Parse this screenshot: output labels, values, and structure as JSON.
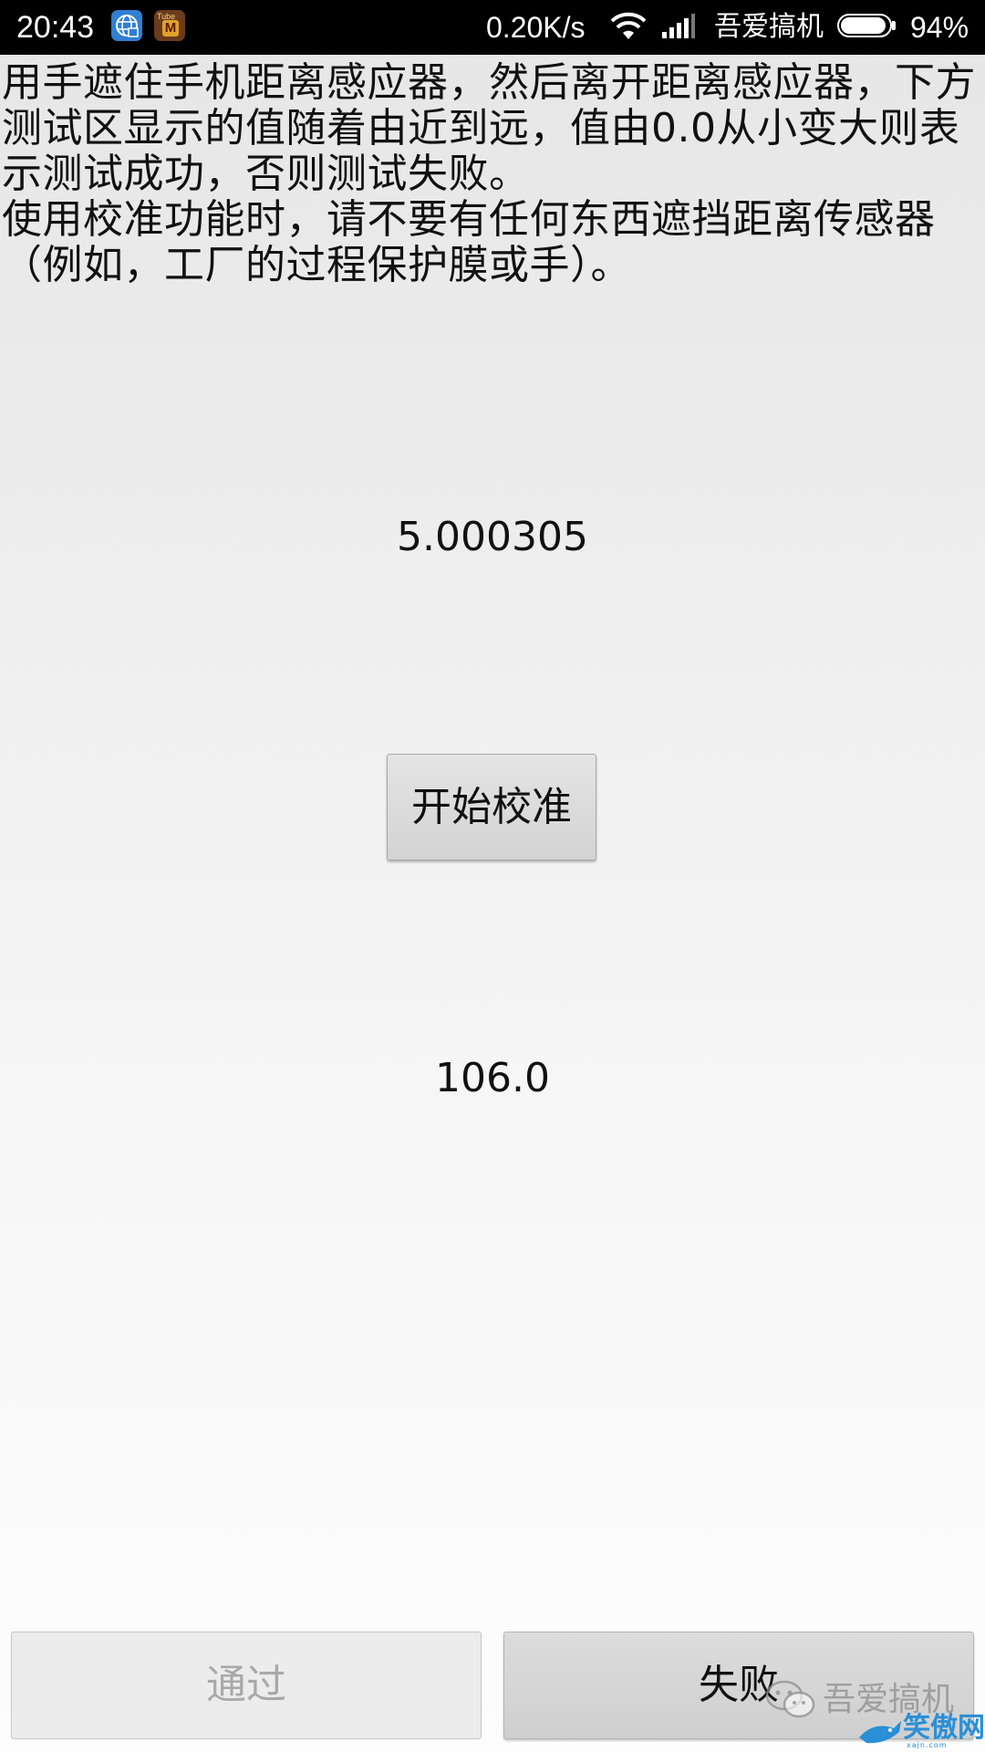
{
  "status_bar": {
    "time": "20:43",
    "network_speed": "0.20K/s",
    "carrier": "吾爱搞机",
    "battery_percent": "94%",
    "battery_level": 0.94,
    "app_icons": [
      "browser-globe-icon",
      "game-app-icon"
    ],
    "game_icon_text": "Tube",
    "game_icon_letter": "M"
  },
  "instructions": {
    "paragraph_1": "用手遮住手机距离感应器，然后离开距离感应器，下方测试区显示的值随着由近到远，值由0.0从小变大则表示测试成功，否则测试失败。",
    "paragraph_2": "使用校准功能时，请不要有任何东西遮挡距离传感器（例如，工厂的过程保护膜或手）。"
  },
  "readings": {
    "value_1": "5.000305",
    "value_2": "106.0"
  },
  "buttons": {
    "calibrate": "开始校准",
    "pass": "通过",
    "fail": "失败"
  },
  "watermark": {
    "text": "吾爱搞机",
    "site": "笑傲网",
    "site_sub": "xajn.com"
  },
  "colors": {
    "status_bar_bg": "#000000",
    "button_bg": "#d6d6d6",
    "disabled_text": "#a9a9a9",
    "site_blue": "#2a8fd6"
  }
}
